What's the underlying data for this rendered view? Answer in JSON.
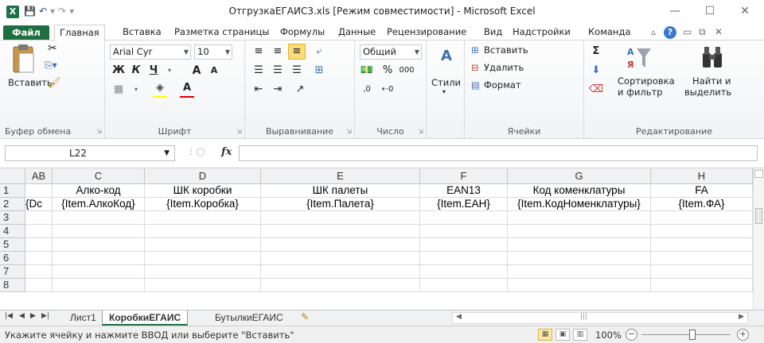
{
  "window": {
    "title": "ОтгрузкаЕГАИС3.xls  [Режим совместимости]  -  Microsoft Excel",
    "app_icon": "X",
    "controls": [
      "—",
      "☐",
      "✕"
    ]
  },
  "ribbon_tabs": [
    {
      "label": "Файл"
    },
    {
      "label": "Главная"
    },
    {
      "label": "Вставка"
    },
    {
      "label": "Разметка страницы"
    },
    {
      "label": "Формулы"
    },
    {
      "label": "Данные"
    },
    {
      "label": "Рецензирование"
    },
    {
      "label": "Вид"
    },
    {
      "label": "Надстройки"
    },
    {
      "label": "Команда"
    }
  ],
  "ribbon": {
    "clipboard": {
      "paste": "Вставить",
      "label": "Буфер обмена"
    },
    "font": {
      "name": "Arial Cyr",
      "size": "10",
      "bold": "Ж",
      "italic": "К",
      "underline": "Ч",
      "grow": "A",
      "shrink": "A",
      "label": "Шрифт"
    },
    "alignment": {
      "label": "Выравнивание"
    },
    "number": {
      "format": "Общий",
      "percent": "%",
      "thousands": "000",
      "inc": ",0",
      "label": "Число"
    },
    "styles": {
      "label": "Стили"
    },
    "cells": {
      "insert": "Вставить",
      "delete": "Удалить",
      "format": "Формат",
      "label": "Ячейки"
    },
    "editing": {
      "sigma": "Σ",
      "sort": "Сортировка",
      "sort2": "и фильтр",
      "find": "Найти и",
      "find2": "выделить",
      "label": "Редактирование"
    }
  },
  "formula_bar": {
    "name_box": "L22",
    "fx": "fx",
    "value": ""
  },
  "columns": [
    "AB",
    "C",
    "D",
    "E",
    "F",
    "G",
    "H"
  ],
  "rows": [
    {
      "num": "1",
      "cells": [
        "",
        "Алко-код",
        "ШК коробки",
        "ШК палеты",
        "EAN13",
        "Код коменклатуры",
        "FA"
      ]
    },
    {
      "num": "2",
      "cells": [
        "{Dc",
        "{Item.АлкоКод}",
        "{Item.Коробка}",
        "{Item.Палета}",
        "{Item.ЕАН}",
        "{Item.КодНоменклатуры}",
        "{Item.ФА}"
      ]
    },
    {
      "num": "3",
      "cells": [
        "",
        "",
        "",
        "",
        "",
        "",
        ""
      ]
    },
    {
      "num": "4",
      "cells": [
        "",
        "",
        "",
        "",
        "",
        "",
        ""
      ]
    },
    {
      "num": "5",
      "cells": [
        "",
        "",
        "",
        "",
        "",
        "",
        ""
      ]
    },
    {
      "num": "6",
      "cells": [
        "",
        "",
        "",
        "",
        "",
        "",
        ""
      ]
    },
    {
      "num": "7",
      "cells": [
        "",
        "",
        "",
        "",
        "",
        "",
        ""
      ]
    },
    {
      "num": "8",
      "cells": [
        "",
        "",
        "",
        "",
        "",
        "",
        ""
      ]
    }
  ],
  "sheets": [
    {
      "label": "Лист1",
      "active": false
    },
    {
      "label": "КоробкиЕГАИС",
      "active": true
    },
    {
      "label": "БутылкиЕГАИС",
      "active": false
    }
  ],
  "status": {
    "message": "Укажите ячейку и нажмите ВВОД или выберите \"Вставить\"",
    "zoom": "100%"
  },
  "colors": {
    "file_tab": "#1f6e3f",
    "accent": "#1e7145",
    "selected_button": "#fbdd77"
  }
}
